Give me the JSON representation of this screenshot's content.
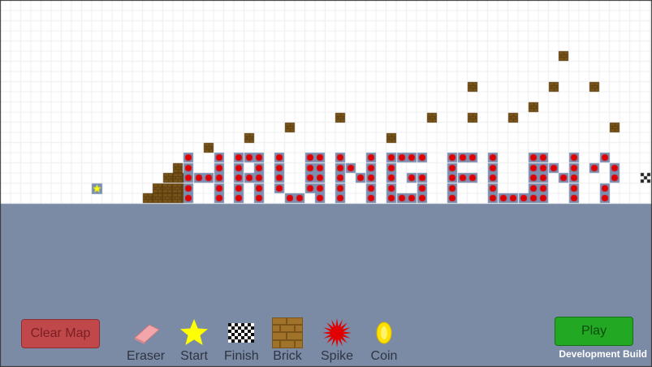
{
  "buttons": {
    "clear_map": "Clear Map",
    "play": "Play"
  },
  "tools": [
    {
      "id": "eraser",
      "label": "Eraser",
      "icon": "eraser-icon"
    },
    {
      "id": "start",
      "label": "Start",
      "icon": "star-icon"
    },
    {
      "id": "finish",
      "label": "Finish",
      "icon": "checkered-flag-icon"
    },
    {
      "id": "brick",
      "label": "Brick",
      "icon": "brick-icon"
    },
    {
      "id": "spike",
      "label": "Spike",
      "icon": "spike-icon"
    },
    {
      "id": "coin",
      "label": "Coin",
      "icon": "coin-icon"
    }
  ],
  "status": {
    "build": "Development Build"
  },
  "colors": {
    "sky": "#ffffff",
    "grid": "#eeeeee",
    "ground": "#7b8ba6",
    "brick": "#7a5418",
    "spike": "#e00000",
    "spike_tile": "#7c8fb0",
    "start_star": "#ffff00",
    "clear_button": "#c0474a",
    "play_button": "#23a823"
  }
}
